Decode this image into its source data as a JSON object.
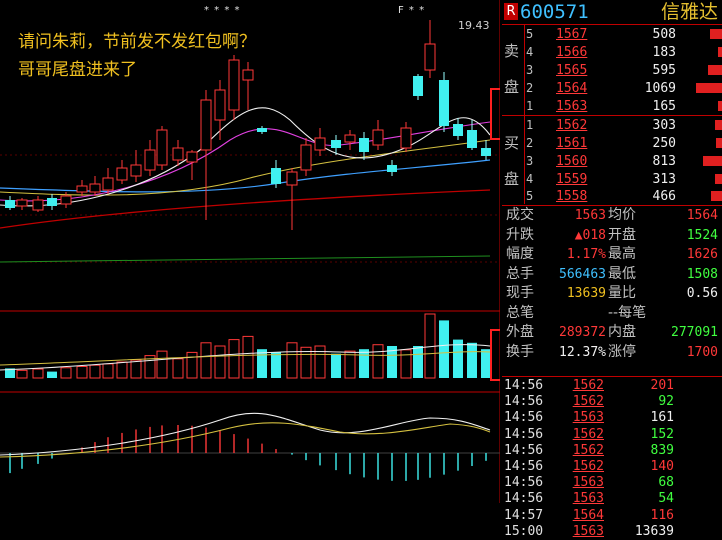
{
  "annotation": {
    "line1": "请问朱莉，节前发不发红包啊？",
    "line2": "哥哥尾盘进来了"
  },
  "chart_marks": {
    "top_stars": "* * * *",
    "right_stars": "F * *",
    "high_label": "19.43"
  },
  "colors": {
    "up": "#ff3838",
    "down": "#40f0f0",
    "accent": "#c00000",
    "label": "#f0c020"
  },
  "stock": {
    "badge": "R",
    "code": "600571",
    "name": "信雅达"
  },
  "order_book": {
    "sell_label": [
      "卖",
      "盘"
    ],
    "buy_label": [
      "买",
      "盘"
    ],
    "sell": [
      {
        "idx": "5",
        "price": "1567",
        "vol": "508",
        "bar": 0.28
      },
      {
        "idx": "4",
        "price": "1566",
        "vol": "183",
        "bar": 0.1
      },
      {
        "idx": "3",
        "price": "1565",
        "vol": "595",
        "bar": 0.32
      },
      {
        "idx": "2",
        "price": "1564",
        "vol": "1069",
        "bar": 0.58
      },
      {
        "idx": "1",
        "price": "1563",
        "vol": "165",
        "bar": 0.09
      }
    ],
    "buy": [
      {
        "idx": "1",
        "price": "1562",
        "vol": "303",
        "bar": 0.17
      },
      {
        "idx": "2",
        "price": "1561",
        "vol": "250",
        "bar": 0.14
      },
      {
        "idx": "3",
        "price": "1560",
        "vol": "813",
        "bar": 0.44
      },
      {
        "idx": "4",
        "price": "1559",
        "vol": "313",
        "bar": 0.17
      },
      {
        "idx": "5",
        "price": "1558",
        "vol": "466",
        "bar": 0.25
      }
    ]
  },
  "quote": [
    {
      "l1": "成交",
      "v1": "1563",
      "c1": "#ff3838",
      "l2": "均价",
      "v2": "1564",
      "c2": "#ff3838"
    },
    {
      "l1": "升跌",
      "v1": "▲018",
      "c1": "#ff3838",
      "l2": "开盘",
      "v2": "1524",
      "c2": "#40ff40"
    },
    {
      "l1": "幅度",
      "v1": "1.17%",
      "c1": "#ff3838",
      "l2": "最高",
      "v2": "1626",
      "c2": "#ff3838"
    },
    {
      "l1": "总手",
      "v1": "566463",
      "c1": "#3fc0ff",
      "l2": "最低",
      "v2": "1508",
      "c2": "#40ff40"
    },
    {
      "l1": "现手",
      "v1": "13639",
      "c1": "#f0c020",
      "l2": "量比",
      "v2": "0.56",
      "c2": "#f0f0f0"
    },
    {
      "l1": "总笔",
      "v1": "",
      "c1": "#f0f0f0",
      "l2": "--每笔",
      "v2": "",
      "c2": "#f0f0f0"
    },
    {
      "l1": "外盘",
      "v1": "289372",
      "c1": "#ff3838",
      "l2": "内盘",
      "v2": "277091",
      "c2": "#40ff40"
    },
    {
      "l1": "换手",
      "v1": "12.37%",
      "c1": "#f0f0f0",
      "l2": "涨停",
      "v2": "1700",
      "c2": "#ff3838"
    }
  ],
  "ticks": [
    {
      "time": "14:56",
      "price": "1562",
      "vol": "201",
      "vc": "#ff3838"
    },
    {
      "time": "14:56",
      "price": "1562",
      "vol": "92",
      "vc": "#40ff40"
    },
    {
      "time": "14:56",
      "price": "1563",
      "vol": "161",
      "vc": "#f0f0f0"
    },
    {
      "time": "14:56",
      "price": "1562",
      "vol": "152",
      "vc": "#40ff40"
    },
    {
      "time": "14:56",
      "price": "1562",
      "vol": "839",
      "vc": "#40ff40"
    },
    {
      "time": "14:56",
      "price": "1562",
      "vol": "140",
      "vc": "#ff3838"
    },
    {
      "time": "14:56",
      "price": "1563",
      "vol": "68",
      "vc": "#40ff40"
    },
    {
      "time": "14:56",
      "price": "1563",
      "vol": "54",
      "vc": "#40ff40"
    },
    {
      "time": "14:57",
      "price": "1564",
      "vol": "116",
      "vc": "#ff3838"
    },
    {
      "time": "15:00",
      "price": "1563",
      "vol": "13639",
      "vc": "#f0f0f0"
    }
  ]
}
